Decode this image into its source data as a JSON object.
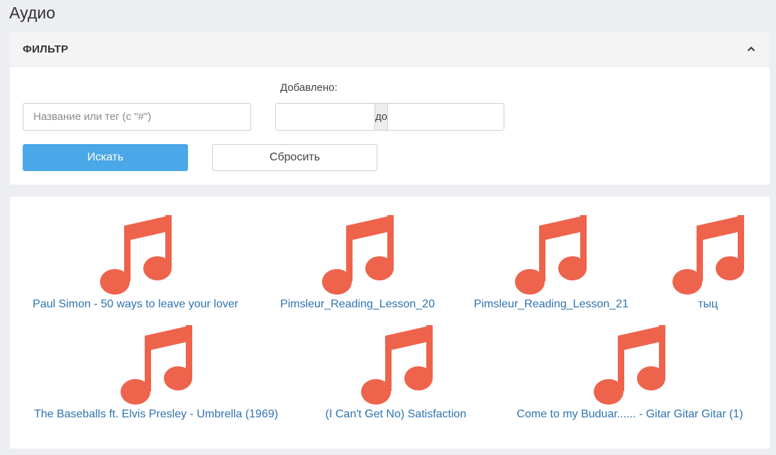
{
  "page": {
    "title": "Аудио"
  },
  "filter": {
    "title": "ФИЛЬТР",
    "added_label": "Добавлено:",
    "name_placeholder": "Название или тег (с \"#\")",
    "date_separator": "до",
    "search_label": "Искать",
    "reset_label": "Сбросить"
  },
  "colors": {
    "note": "#ee634c",
    "link": "#2f73b0",
    "primary_button": "#4aa7e8"
  },
  "icons": {
    "audio": "music-note-icon",
    "collapse": "chevron-up-icon"
  },
  "audio_items": [
    {
      "title": "Paul Simon - 50 ways to leave your lover"
    },
    {
      "title": "Pimsleur_Reading_Lesson_20"
    },
    {
      "title": "Pimsleur_Reading_Lesson_21"
    },
    {
      "title": "тыц"
    },
    {
      "title": "The Baseballs ft. Elvis Presley - Umbrella (1969)"
    },
    {
      "title": "(I Can't Get No) Satisfaction"
    },
    {
      "title": "Come to my Buduar...... - Gitar Gitar Gitar (1)"
    }
  ]
}
